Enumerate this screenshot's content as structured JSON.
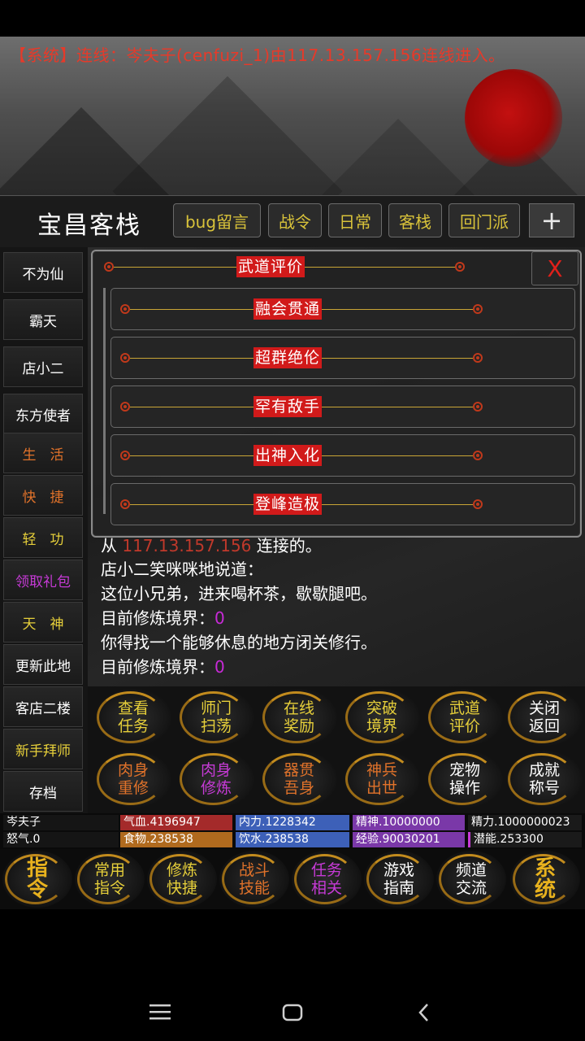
{
  "system_message": "【系统】连线：岑夫子(cenfuzi_1)由117.13.157.156连线进入。",
  "header": {
    "room": "宝昌客栈",
    "buttons": [
      "bug留言",
      "战令",
      "日常",
      "客栈",
      "回门派"
    ],
    "plus": "+"
  },
  "sidebar": [
    {
      "label": "不为仙",
      "color": "#ffffff"
    },
    {
      "label": "霸天",
      "color": "#ffffff"
    },
    {
      "label": "店小二",
      "color": "#ffffff"
    },
    {
      "label": "东方使者",
      "color": "#ffffff"
    },
    {
      "label": "生　活",
      "color": "#e0722a"
    },
    {
      "label": "快　捷",
      "color": "#e0722a"
    },
    {
      "label": "轻　功",
      "color": "#e6cf3a"
    },
    {
      "label": "领取礼包",
      "color": "#c63ad6"
    },
    {
      "label": "天　神",
      "color": "#e6cf3a"
    },
    {
      "label": "更新此地",
      "color": "#ffffff"
    },
    {
      "label": "客店二楼",
      "color": "#ffffff"
    },
    {
      "label": "新手拜师",
      "color": "#e6cf3a"
    },
    {
      "label": "存档",
      "color": "#ffffff"
    }
  ],
  "dialog": {
    "title": "武道评价",
    "close": "X",
    "items": [
      "融会贯通",
      "超群绝伦",
      "罕有敌手",
      "出神入化",
      "登峰造极"
    ]
  },
  "log": {
    "partial_prefix": "从",
    "partial_ip": "117.13.157.156",
    "partial_suffix": "连接的。",
    "line1": "店小二笑咪咪地说道：",
    "line2": "这位小兄弟，进来喝杯茶，歇歇腿吧。",
    "line3_label": "目前修炼境界：",
    "line3_value": "0",
    "line4": "你得找一个能够休息的地方闭关修行。",
    "line5_label": "目前修炼境界：",
    "line5_value": "0"
  },
  "actions": [
    {
      "l1": "查看",
      "l2": "任务",
      "color": "#e6cf3a"
    },
    {
      "l1": "师门",
      "l2": "扫荡",
      "color": "#e6cf3a"
    },
    {
      "l1": "在线",
      "l2": "奖励",
      "color": "#e6cf3a"
    },
    {
      "l1": "突破",
      "l2": "境界",
      "color": "#e6cf3a"
    },
    {
      "l1": "武道",
      "l2": "评价",
      "color": "#e6cf3a"
    },
    {
      "l1": "关闭",
      "l2": "返回",
      "color": "#ffffff"
    },
    {
      "l1": "肉身",
      "l2": "重修",
      "color": "#e0722a"
    },
    {
      "l1": "肉身",
      "l2": "修炼",
      "color": "#c63ad6"
    },
    {
      "l1": "器贯",
      "l2": "吾身",
      "color": "#e0722a"
    },
    {
      "l1": "神兵",
      "l2": "出世",
      "color": "#e0722a"
    },
    {
      "l1": "宠物",
      "l2": "操作",
      "color": "#ffffff"
    },
    {
      "l1": "成就",
      "l2": "称号",
      "color": "#ffffff"
    }
  ],
  "stats": {
    "name": "岑夫子",
    "qixue": "气血.4196947",
    "neili": "内力.1228342",
    "jingshen": "精神.10000000",
    "jingli": "精力.1000000023",
    "nuqi": "怒气.0",
    "shiwu": "食物.238538",
    "yinshui": "饮水.238538",
    "jingyan": "经验.90030201",
    "qianneng": "潜能.253300"
  },
  "bottom": [
    {
      "l1": "指",
      "l2": "令",
      "calligraphy": true
    },
    {
      "l1": "常用",
      "l2": "指令",
      "color": "#e6cf3a"
    },
    {
      "l1": "修炼",
      "l2": "快捷",
      "color": "#e6cf3a"
    },
    {
      "l1": "战斗",
      "l2": "技能",
      "color": "#e0722a"
    },
    {
      "l1": "任务",
      "l2": "相关",
      "color": "#c63ad6"
    },
    {
      "l1": "游戏",
      "l2": "指南",
      "color": "#ffffff"
    },
    {
      "l1": "频道",
      "l2": "交流",
      "color": "#ffffff"
    },
    {
      "l1": "系",
      "l2": "统",
      "calligraphy": true
    }
  ]
}
